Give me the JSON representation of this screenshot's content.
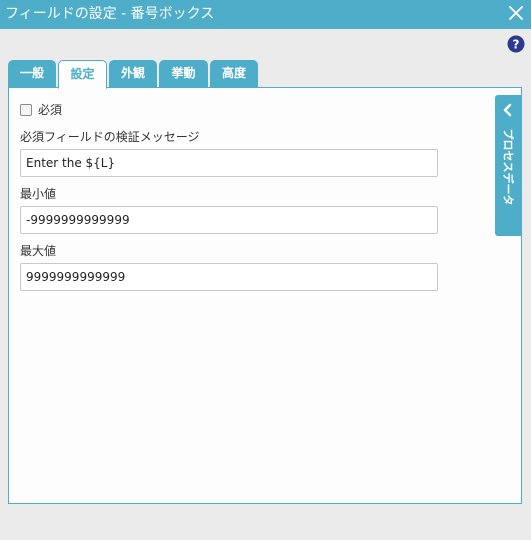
{
  "window": {
    "title": "フィールドの設定 - 番号ボックス",
    "accent_color": "#4eaec9"
  },
  "tabs": [
    {
      "label": "一般",
      "active": false
    },
    {
      "label": "設定",
      "active": true
    },
    {
      "label": "外観",
      "active": false
    },
    {
      "label": "挙動",
      "active": false
    },
    {
      "label": "高度",
      "active": false
    }
  ],
  "settings": {
    "required_label": "必須",
    "required_checked": false,
    "validation_message_label": "必須フィールドの検証メッセージ",
    "validation_message_value": "Enter the ${L}",
    "min_label": "最小値",
    "min_value": "-9999999999999",
    "max_label": "最大値",
    "max_value": "9999999999999"
  },
  "side_panel": {
    "label": "プロセスデータ",
    "icon": "chevron-left-icon"
  },
  "icons": {
    "close": "close-icon",
    "help": "help-icon"
  }
}
